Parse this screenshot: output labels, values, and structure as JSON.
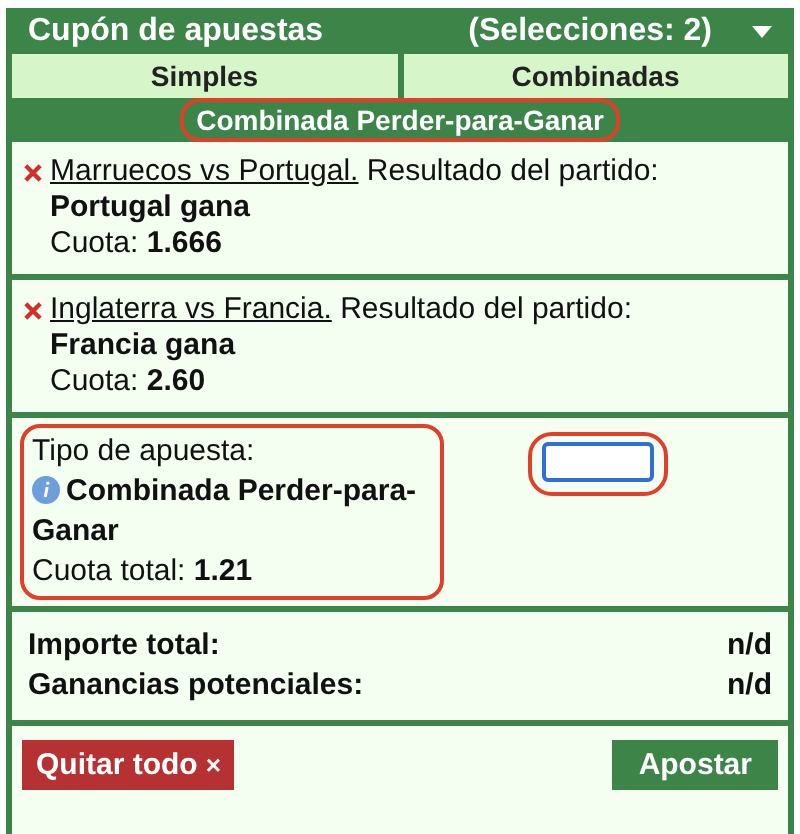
{
  "header": {
    "title": "Cupón de apuestas",
    "count": "(Selecciones: 2)"
  },
  "tabs": [
    {
      "label": "Simples",
      "selected": false
    },
    {
      "label": "Combinadas",
      "selected": false
    }
  ],
  "bet_mode": {
    "label": "Combinada Perder-para-Ganar",
    "highlighted": true
  },
  "selections": [
    {
      "match": "Marruecos vs Portugal.",
      "market": "Resultado del partido:",
      "pick": "Portugal gana",
      "odds_label": "Cuota:",
      "odds": "1.666"
    },
    {
      "match": "Inglaterra vs Francia.",
      "market": "Resultado del partido:",
      "pick": "Francia gana",
      "odds_label": "Cuota:",
      "odds": "2.60"
    }
  ],
  "bet_type": {
    "label": "Tipo de apuesta:",
    "name": "Combinada Perder-para-Ganar",
    "total_label": "Cuota total:",
    "total_odds": "1.21",
    "highlighted": true,
    "stake_highlighted": true
  },
  "totals": [
    {
      "label": "Importe total:",
      "value": "n/d"
    },
    {
      "label": "Ganancias potenciales:",
      "value": "n/d"
    }
  ],
  "actions": {
    "clear": "Quitar todo",
    "clear_icon": "×",
    "place": "Apostar"
  }
}
